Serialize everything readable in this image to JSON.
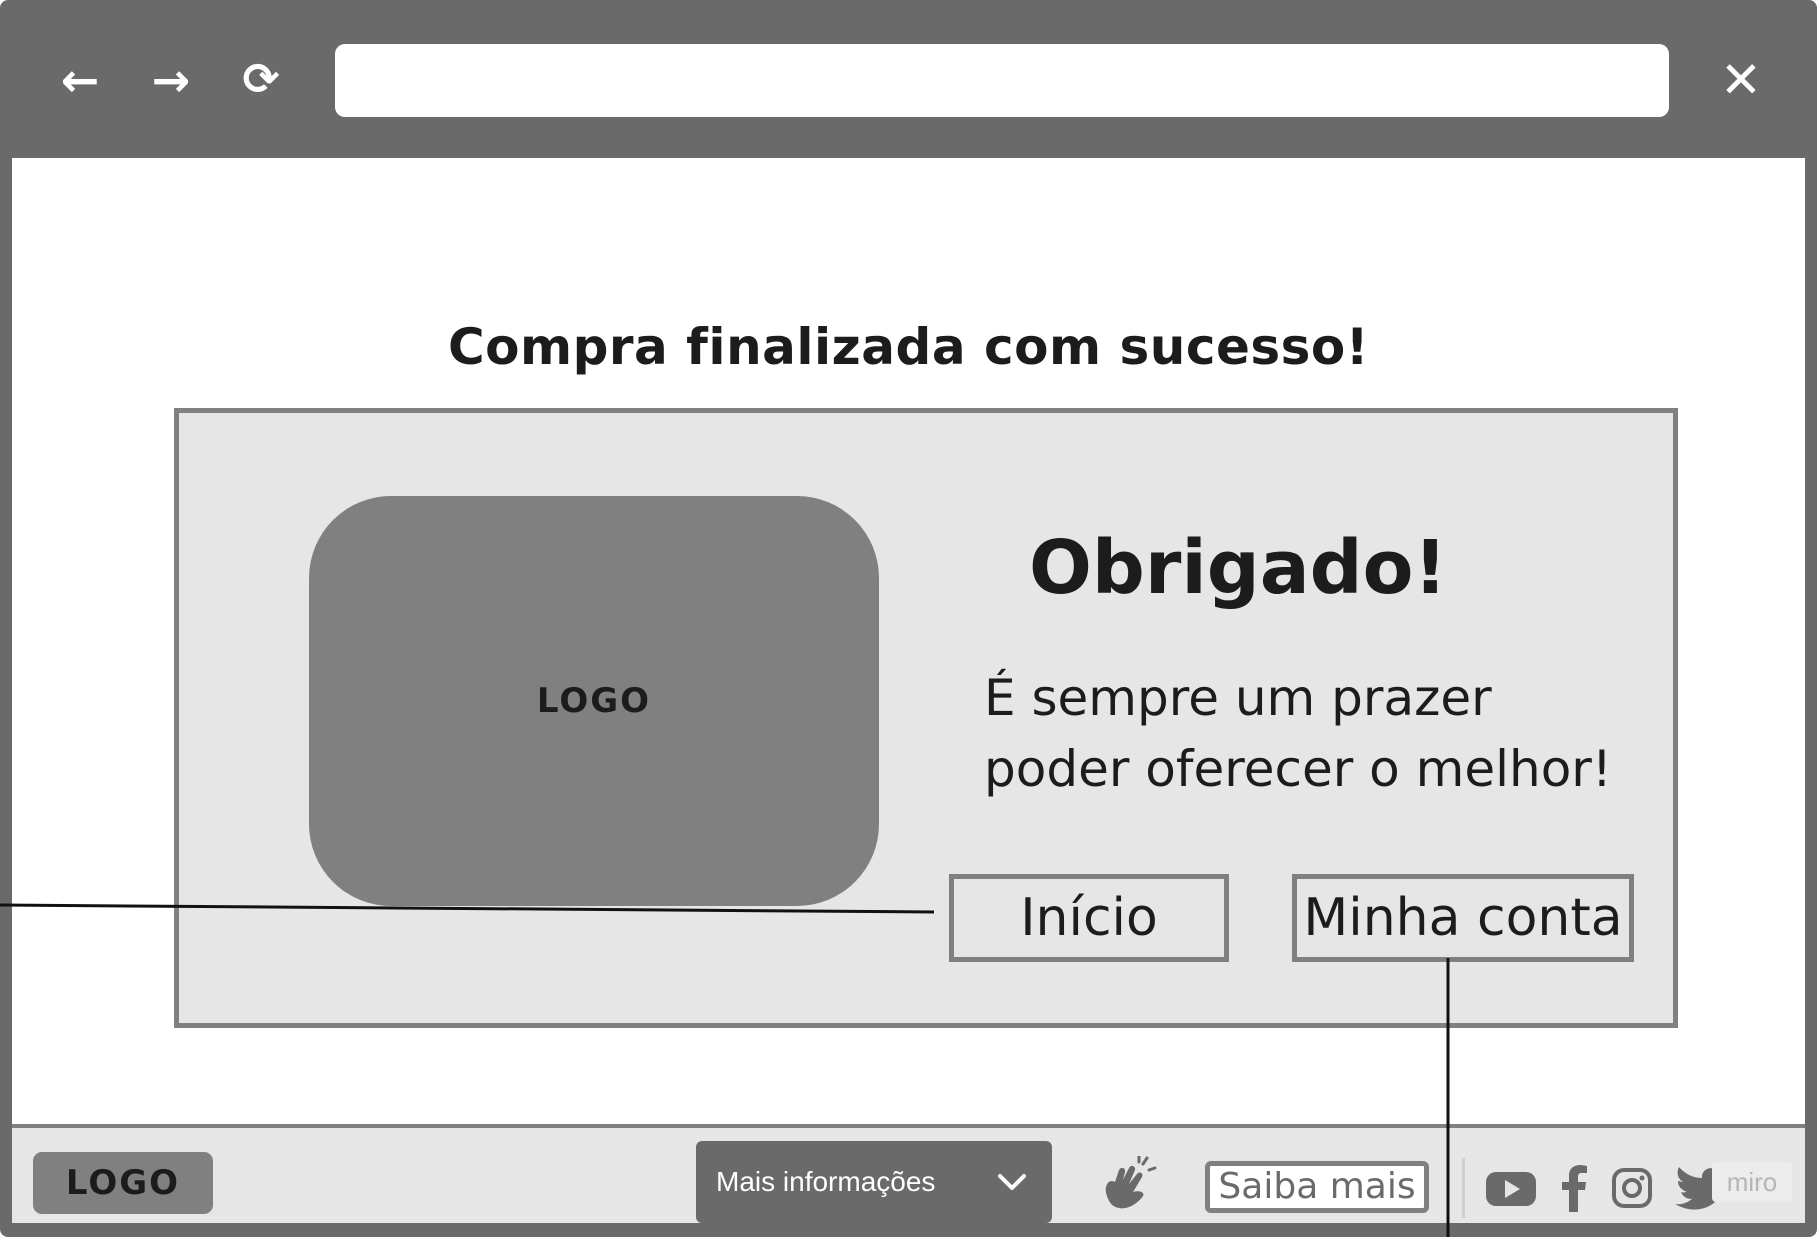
{
  "browser": {
    "back_icon": "←",
    "forward_icon": "→",
    "reload_icon": "⟳",
    "close_icon": "✕",
    "url_value": ""
  },
  "page": {
    "title": "Compra finalizada com sucesso!"
  },
  "card": {
    "logo_label": "LOGO",
    "heading": "Obrigado!",
    "message_line1": "É sempre um prazer",
    "message_line2": "poder oferecer o melhor!",
    "home_button": "Início",
    "account_button": "Minha conta"
  },
  "footer": {
    "logo_label": "LOGO",
    "dropdown_label": "Mais informações",
    "learn_more_button": "Saiba mais",
    "watermark": "miro",
    "icons": [
      "accessibility-hands-icon",
      "youtube-icon",
      "facebook-icon",
      "instagram-icon",
      "twitter-icon",
      "chevron-down-icon"
    ]
  },
  "colors": {
    "chrome": "#6a6a6a",
    "card_bg": "#e6e6e6",
    "border": "#808080",
    "text": "#1c1c1c"
  }
}
